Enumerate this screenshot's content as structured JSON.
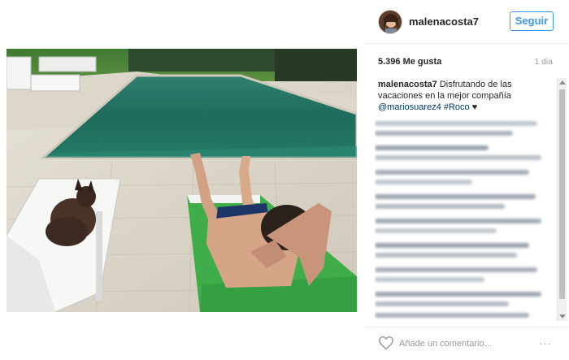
{
  "post": {
    "username": "malenacosta7",
    "follow_label": "Seguir",
    "likes": "5.396 Me gusta",
    "time_ago": "1 día",
    "caption": {
      "user": "malenacosta7",
      "text": " Disfrutando de las vacaciones en la mejor compañía ",
      "mention": "@mariosuarez4",
      "hashtag": "#Roco",
      "emoji": "♥"
    },
    "comment_placeholder": "Añade un comentario...",
    "more_label": "···"
  },
  "colors": {
    "accent": "#3897f0",
    "link": "#003569",
    "pool_water": "#1f6b5c",
    "towel": "#3fae4a"
  },
  "icons": [
    "heart-icon",
    "more-options-icon",
    "avatar"
  ]
}
